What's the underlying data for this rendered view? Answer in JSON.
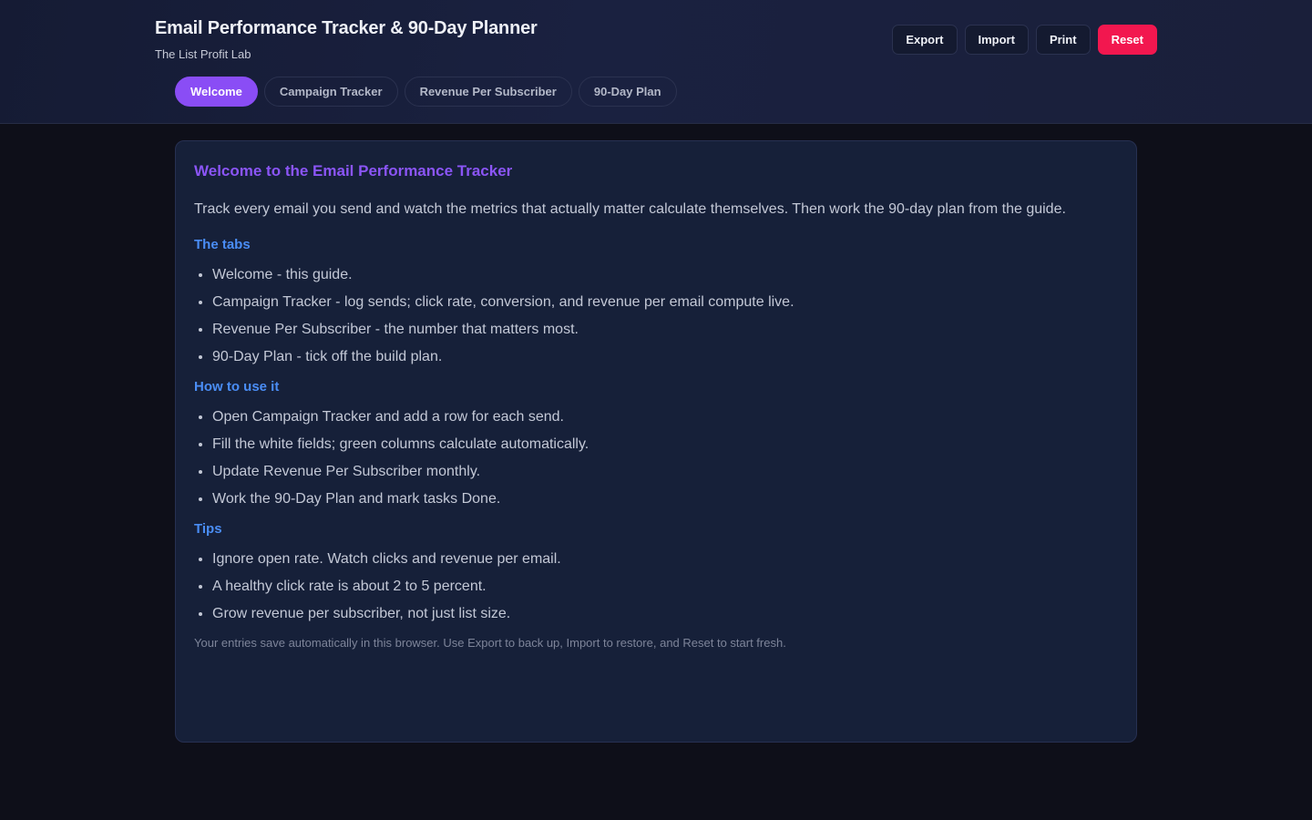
{
  "header": {
    "title": "Email Performance Tracker & 90-Day Planner",
    "subtitle": "The List Profit Lab",
    "actions": {
      "export_label": "Export",
      "import_label": "Import",
      "print_label": "Print",
      "reset_label": "Reset"
    }
  },
  "tabs": [
    {
      "label": "Welcome",
      "active": true
    },
    {
      "label": "Campaign Tracker",
      "active": false
    },
    {
      "label": "Revenue Per Subscriber",
      "active": false
    },
    {
      "label": "90-Day Plan",
      "active": false
    }
  ],
  "welcome": {
    "heading": "Welcome to the Email Performance Tracker",
    "intro": "Track every email you send and watch the metrics that actually matter calculate themselves. Then work the 90-day plan from the guide.",
    "sections": [
      {
        "heading": "The tabs",
        "items": [
          "Welcome - this guide.",
          "Campaign Tracker - log sends; click rate, conversion, and revenue per email compute live.",
          "Revenue Per Subscriber - the number that matters most.",
          "90-Day Plan - tick off the build plan."
        ]
      },
      {
        "heading": "How to use it",
        "items": [
          "Open Campaign Tracker and add a row for each send.",
          "Fill the white fields; green columns calculate automatically.",
          "Update Revenue Per Subscriber monthly.",
          "Work the 90-Day Plan and mark tasks Done."
        ]
      },
      {
        "heading": "Tips",
        "items": [
          "Ignore open rate. Watch clicks and revenue per email.",
          "A healthy click rate is about 2 to 5 percent.",
          "Grow revenue per subscriber, not just list size."
        ]
      }
    ],
    "footnote": "Your entries save automatically in this browser. Use Export to back up, Import to restore, and Reset to start fresh."
  },
  "colors": {
    "accent_purple": "#8a4df5",
    "section_blue": "#4a8df5",
    "reset_red": "#f2174f",
    "background": "#0e0f19",
    "card": "#162039"
  }
}
